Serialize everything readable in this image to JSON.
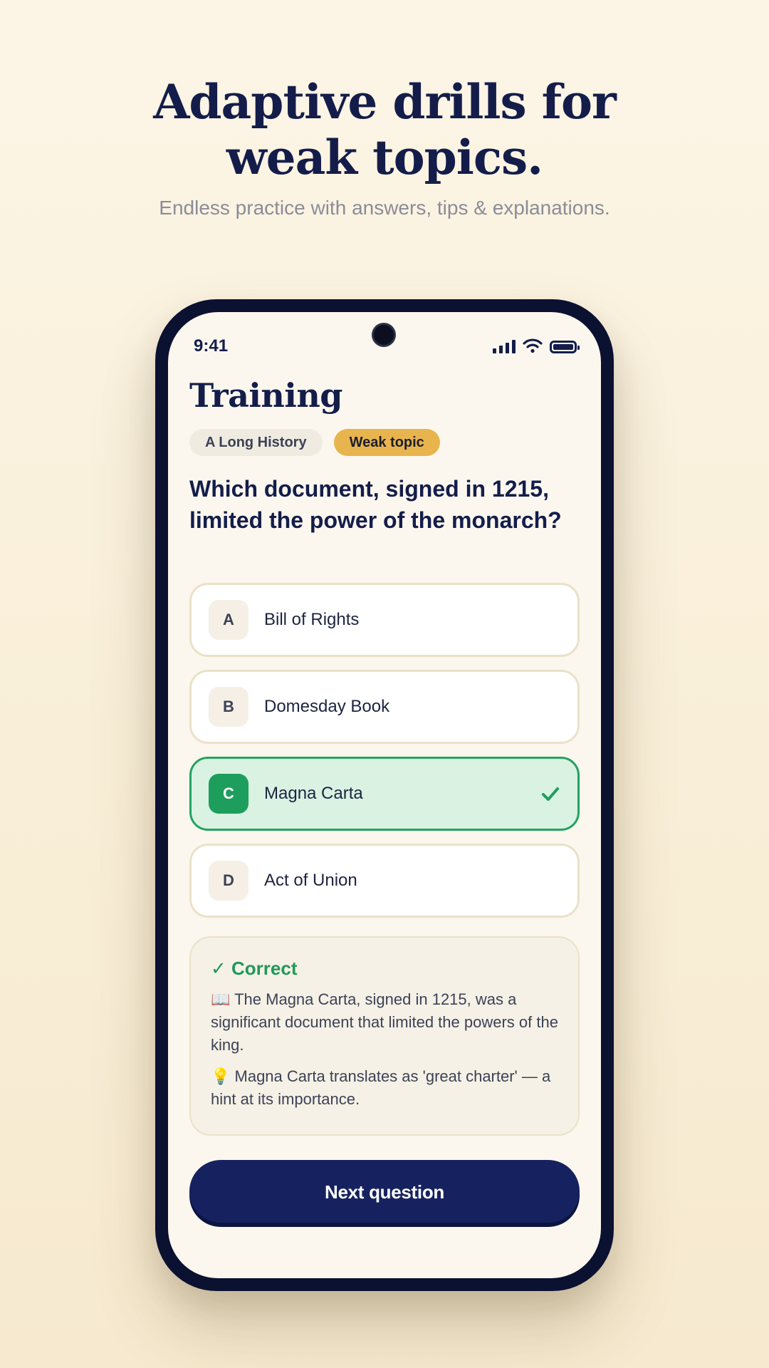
{
  "hero": {
    "headline_line1": "Adaptive drills for",
    "headline_line2": "weak topics.",
    "subheadline": "Endless practice with answers, tips & explanations."
  },
  "status_bar": {
    "time": "9:41",
    "icons": [
      "signal-icon",
      "wifi-icon",
      "battery-icon"
    ]
  },
  "screen": {
    "title": "Training",
    "chips": {
      "topic": "A Long History",
      "tag": "Weak topic"
    },
    "question": "Which document, signed in 1215, limited the power of the monarch?",
    "answers": [
      {
        "letter": "A",
        "text": "Bill of Rights"
      },
      {
        "letter": "B",
        "text": "Domesday Book"
      },
      {
        "letter": "C",
        "text": "Magna Carta"
      },
      {
        "letter": "D",
        "text": "Act of Union"
      }
    ],
    "feedback": {
      "title": "✓ Correct",
      "explanation": "📖 The Magna Carta, signed in 1215, was a significant document that limited the powers of the king.",
      "tip": "💡 Magna Carta translates as 'great charter' — a hint at its importance."
    },
    "next_button": "Next question"
  },
  "colors": {
    "navy": "#141d4a",
    "accent_gold": "#e8b44e",
    "correct_green": "#1e9e5c",
    "correct_bg": "#d9f2e2",
    "button": "#162260"
  }
}
